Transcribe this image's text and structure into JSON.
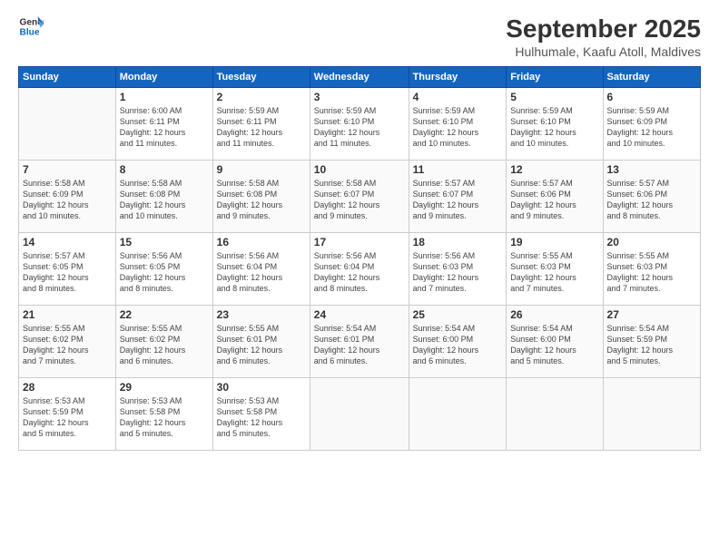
{
  "logo": {
    "line1": "General",
    "line2": "Blue"
  },
  "title": "September 2025",
  "subtitle": "Hulhumale, Kaafu Atoll, Maldives",
  "days_header": [
    "Sunday",
    "Monday",
    "Tuesday",
    "Wednesday",
    "Thursday",
    "Friday",
    "Saturday"
  ],
  "weeks": [
    [
      {
        "day": "",
        "info": ""
      },
      {
        "day": "1",
        "info": "Sunrise: 6:00 AM\nSunset: 6:11 PM\nDaylight: 12 hours\nand 11 minutes."
      },
      {
        "day": "2",
        "info": "Sunrise: 5:59 AM\nSunset: 6:11 PM\nDaylight: 12 hours\nand 11 minutes."
      },
      {
        "day": "3",
        "info": "Sunrise: 5:59 AM\nSunset: 6:10 PM\nDaylight: 12 hours\nand 11 minutes."
      },
      {
        "day": "4",
        "info": "Sunrise: 5:59 AM\nSunset: 6:10 PM\nDaylight: 12 hours\nand 10 minutes."
      },
      {
        "day": "5",
        "info": "Sunrise: 5:59 AM\nSunset: 6:10 PM\nDaylight: 12 hours\nand 10 minutes."
      },
      {
        "day": "6",
        "info": "Sunrise: 5:59 AM\nSunset: 6:09 PM\nDaylight: 12 hours\nand 10 minutes."
      }
    ],
    [
      {
        "day": "7",
        "info": "Sunrise: 5:58 AM\nSunset: 6:09 PM\nDaylight: 12 hours\nand 10 minutes."
      },
      {
        "day": "8",
        "info": "Sunrise: 5:58 AM\nSunset: 6:08 PM\nDaylight: 12 hours\nand 10 minutes."
      },
      {
        "day": "9",
        "info": "Sunrise: 5:58 AM\nSunset: 6:08 PM\nDaylight: 12 hours\nand 9 minutes."
      },
      {
        "day": "10",
        "info": "Sunrise: 5:58 AM\nSunset: 6:07 PM\nDaylight: 12 hours\nand 9 minutes."
      },
      {
        "day": "11",
        "info": "Sunrise: 5:57 AM\nSunset: 6:07 PM\nDaylight: 12 hours\nand 9 minutes."
      },
      {
        "day": "12",
        "info": "Sunrise: 5:57 AM\nSunset: 6:06 PM\nDaylight: 12 hours\nand 9 minutes."
      },
      {
        "day": "13",
        "info": "Sunrise: 5:57 AM\nSunset: 6:06 PM\nDaylight: 12 hours\nand 8 minutes."
      }
    ],
    [
      {
        "day": "14",
        "info": "Sunrise: 5:57 AM\nSunset: 6:05 PM\nDaylight: 12 hours\nand 8 minutes."
      },
      {
        "day": "15",
        "info": "Sunrise: 5:56 AM\nSunset: 6:05 PM\nDaylight: 12 hours\nand 8 minutes."
      },
      {
        "day": "16",
        "info": "Sunrise: 5:56 AM\nSunset: 6:04 PM\nDaylight: 12 hours\nand 8 minutes."
      },
      {
        "day": "17",
        "info": "Sunrise: 5:56 AM\nSunset: 6:04 PM\nDaylight: 12 hours\nand 8 minutes."
      },
      {
        "day": "18",
        "info": "Sunrise: 5:56 AM\nSunset: 6:03 PM\nDaylight: 12 hours\nand 7 minutes."
      },
      {
        "day": "19",
        "info": "Sunrise: 5:55 AM\nSunset: 6:03 PM\nDaylight: 12 hours\nand 7 minutes."
      },
      {
        "day": "20",
        "info": "Sunrise: 5:55 AM\nSunset: 6:03 PM\nDaylight: 12 hours\nand 7 minutes."
      }
    ],
    [
      {
        "day": "21",
        "info": "Sunrise: 5:55 AM\nSunset: 6:02 PM\nDaylight: 12 hours\nand 7 minutes."
      },
      {
        "day": "22",
        "info": "Sunrise: 5:55 AM\nSunset: 6:02 PM\nDaylight: 12 hours\nand 6 minutes."
      },
      {
        "day": "23",
        "info": "Sunrise: 5:55 AM\nSunset: 6:01 PM\nDaylight: 12 hours\nand 6 minutes."
      },
      {
        "day": "24",
        "info": "Sunrise: 5:54 AM\nSunset: 6:01 PM\nDaylight: 12 hours\nand 6 minutes."
      },
      {
        "day": "25",
        "info": "Sunrise: 5:54 AM\nSunset: 6:00 PM\nDaylight: 12 hours\nand 6 minutes."
      },
      {
        "day": "26",
        "info": "Sunrise: 5:54 AM\nSunset: 6:00 PM\nDaylight: 12 hours\nand 5 minutes."
      },
      {
        "day": "27",
        "info": "Sunrise: 5:54 AM\nSunset: 5:59 PM\nDaylight: 12 hours\nand 5 minutes."
      }
    ],
    [
      {
        "day": "28",
        "info": "Sunrise: 5:53 AM\nSunset: 5:59 PM\nDaylight: 12 hours\nand 5 minutes."
      },
      {
        "day": "29",
        "info": "Sunrise: 5:53 AM\nSunset: 5:58 PM\nDaylight: 12 hours\nand 5 minutes."
      },
      {
        "day": "30",
        "info": "Sunrise: 5:53 AM\nSunset: 5:58 PM\nDaylight: 12 hours\nand 5 minutes."
      },
      {
        "day": "",
        "info": ""
      },
      {
        "day": "",
        "info": ""
      },
      {
        "day": "",
        "info": ""
      },
      {
        "day": "",
        "info": ""
      }
    ]
  ]
}
